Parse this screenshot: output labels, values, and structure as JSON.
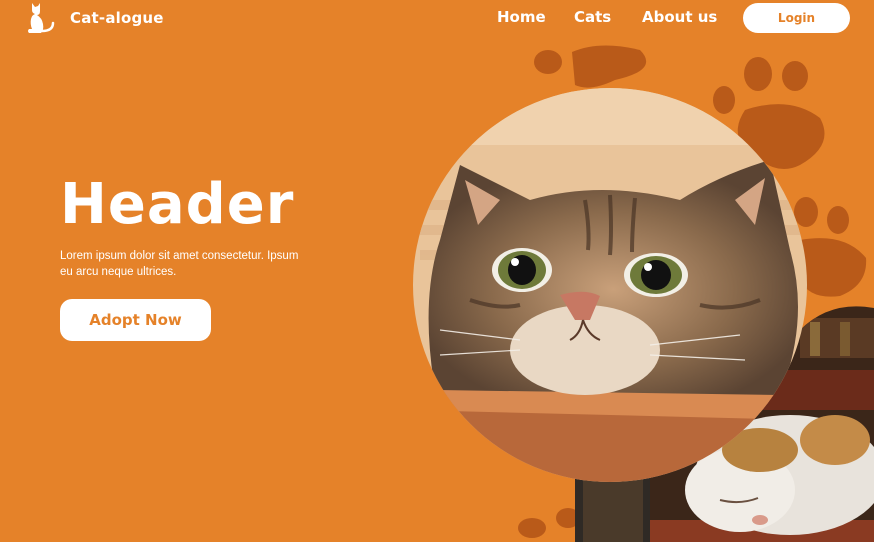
{
  "brand": {
    "name": "Cat-alogue",
    "logo_icon": "cat-silhouette-icon"
  },
  "nav": {
    "items": [
      {
        "label": "Home"
      },
      {
        "label": "Cats"
      },
      {
        "label": "About us"
      }
    ],
    "login_label": "Login"
  },
  "hero": {
    "title": "Header",
    "subtitle": "Lorem ipsum dolor sit amet consectetur. Ipsum eu arcu neque ultrices.",
    "cta_label": "Adopt Now",
    "images": [
      "surprised-tabby-cat-photo",
      "sleeping-cat-on-books-photo"
    ],
    "decoration": "paw-prints"
  },
  "colors": {
    "background": "#E58229",
    "paw": "#B95A19",
    "button_bg": "#FFFFFF",
    "button_text": "#E58229"
  }
}
